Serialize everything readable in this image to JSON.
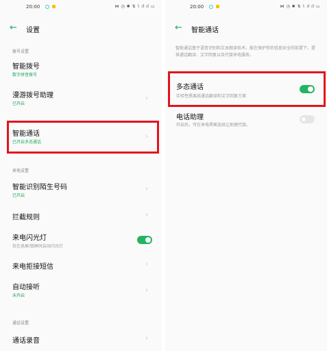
{
  "status": {
    "time": "20:00",
    "icons": "⋈ ◷ ✱ ⇅ ⌇ ıl ıl ▭"
  },
  "left": {
    "title": "设置",
    "sections": {
      "dial": "拨号设置",
      "incoming": "来电设置",
      "call": "通话设置"
    },
    "rows": {
      "smart_dial": {
        "title": "智能拨号",
        "sub": "数字拼音拨号"
      },
      "roaming": {
        "title": "漫游拨号助理",
        "sub": "已开启"
      },
      "smart_call": {
        "title": "智能通话",
        "sub": "已开启多态通话"
      },
      "stranger": {
        "title": "智能识别陌生号码",
        "sub": "已开启"
      },
      "intercept": {
        "title": "拦截规则"
      },
      "flash": {
        "title": "来电闪光灯",
        "sub": "仅在息屏/锁屏时启动闪光灯",
        "on": true
      },
      "reject_sms": {
        "title": "来电拒接短信"
      },
      "auto_answer": {
        "title": "自动接听",
        "sub": "未开启"
      },
      "record": {
        "title": "通话录音"
      }
    }
  },
  "right": {
    "title": "智能通话",
    "description": "智能通话基于语音识别和文本朗读技术，能在保护你的信息安全的前提下，提供通话翻译、文字回复以及代接来电服务。",
    "rows": {
      "multi": {
        "title": "多态通话",
        "sub": "实验性质离线通话翻译和文字回复方案",
        "on": true
      },
      "assistant": {
        "title": "电话助理",
        "sub": "开启后，可在来电界面选择让助理代接。",
        "on": false
      }
    }
  },
  "colors": {
    "accent": "#22b462",
    "highlight": "#e3121b"
  }
}
